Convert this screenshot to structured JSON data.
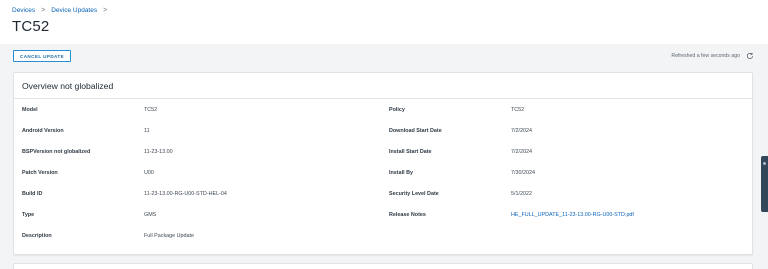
{
  "breadcrumb": {
    "devices": "Devices",
    "device_updates": "Device Updates",
    "separator": ">"
  },
  "page_title": "TC52",
  "toolbar": {
    "cancel_label": "CANCEL UPDATE",
    "refreshed_text": "Refreshed a few seconds ago",
    "refresh_icon": "refresh-icon"
  },
  "card": {
    "title": "Overview not globalized",
    "left": [
      {
        "label": "Model",
        "value": "TC52"
      },
      {
        "label": "Android Version",
        "value": "11"
      },
      {
        "label": "BSPVersion not globalized",
        "value": "11-23-13.00"
      },
      {
        "label": "Patch Version",
        "value": "U00"
      },
      {
        "label": "Build ID",
        "value": "11-23-13.00-RG-U00-STD-HEL-04"
      },
      {
        "label": "Type",
        "value": "GMS"
      },
      {
        "label": "Description",
        "value": "Full Package Update"
      }
    ],
    "right": [
      {
        "label": "Policy",
        "value": "TC52"
      },
      {
        "label": "Download Start Date",
        "value": "7/2/2024"
      },
      {
        "label": "Install Start Date",
        "value": "7/2/2024"
      },
      {
        "label": "Install By",
        "value": "7/30/2024"
      },
      {
        "label": "Security Level Date",
        "value": "5/1/2022"
      },
      {
        "label": "Release Notes",
        "value": "HE_FULL_UPDATE_11-23-13.00-RG-U00-STD.pdf"
      }
    ]
  },
  "colors": {
    "accent": "#0a63b8",
    "button_border": "#2a8ed4",
    "page_bg": "#f3f4f5",
    "side_tab": "#33475b"
  }
}
